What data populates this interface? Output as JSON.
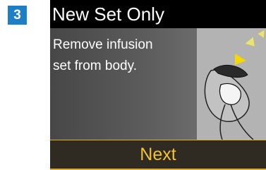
{
  "step": {
    "number": "3"
  },
  "screen": {
    "title": "New Set Only",
    "message_line1": "Remove infusion",
    "message_line2": "set from body.",
    "next_label": "Next"
  },
  "colors": {
    "step_badge": "#1e7fc6",
    "title_bar": "#000000",
    "next_text": "#f1c232",
    "arrow_yellow": "#f5d800"
  },
  "icons": [
    "infusion-set-removal-illustration",
    "arrow-icon"
  ]
}
